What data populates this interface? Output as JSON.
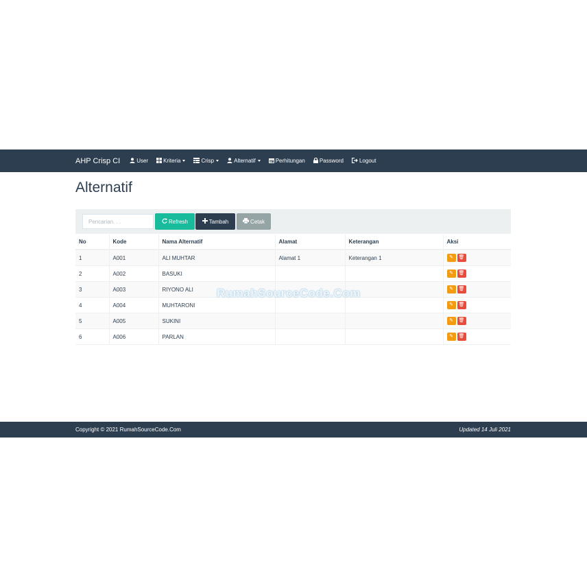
{
  "navbar": {
    "brand": "AHP Crisp CI",
    "items": [
      {
        "label": "User",
        "icon": "user-icon",
        "caret": false
      },
      {
        "label": "Kriteria",
        "icon": "grid-icon",
        "caret": true
      },
      {
        "label": "Crisp",
        "icon": "list-icon",
        "caret": true
      },
      {
        "label": "Alternatif",
        "icon": "user-icon",
        "caret": true
      },
      {
        "label": "Perhitungan",
        "icon": "calendar-icon",
        "caret": false
      },
      {
        "label": "Password",
        "icon": "lock-icon",
        "caret": false
      },
      {
        "label": "Logout",
        "icon": "logout-icon",
        "caret": false
      }
    ]
  },
  "page": {
    "title": "Alternatif"
  },
  "toolbar": {
    "search_placeholder": "Pencarian. . .",
    "refresh_label": "Refresh",
    "add_label": "Tambah",
    "print_label": "Cetak"
  },
  "table": {
    "headers": [
      "No",
      "Kode",
      "Nama Alternatif",
      "Alamat",
      "Keterangan",
      "Aksi"
    ],
    "rows": [
      [
        "1",
        "A001",
        "ALI MUHTAR",
        "Alamat 1",
        "Keterangan 1"
      ],
      [
        "2",
        "A002",
        "BASUKI",
        "",
        ""
      ],
      [
        "3",
        "A003",
        "RIYONO ALI",
        "",
        ""
      ],
      [
        "4",
        "A004",
        "MUHTARONI",
        "",
        ""
      ],
      [
        "5",
        "A005",
        "SUKINI",
        "",
        ""
      ],
      [
        "6",
        "A006",
        "PARLAN",
        "",
        ""
      ]
    ]
  },
  "watermark": "RumahSourceCode.Com",
  "footer": {
    "copyright": "Copyright © 2021 RumahSourceCode.Com",
    "updated": "Updated 14 Juli 2021"
  },
  "colors": {
    "primary": "#2c3e50",
    "success": "#18bc9c",
    "default": "#95a5a6",
    "warning": "#f39c12",
    "danger": "#e74c3c"
  }
}
